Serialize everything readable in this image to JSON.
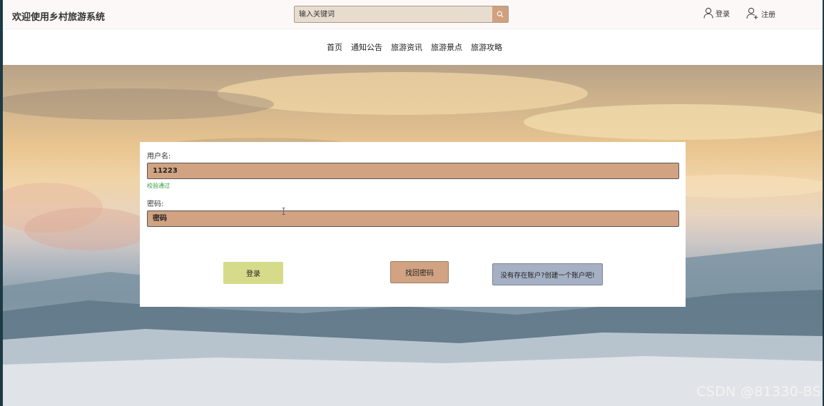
{
  "header": {
    "site_title": "欢迎使用乡村旅游系统",
    "search_placeholder": "输入关键词",
    "search_icon": "search-icon",
    "login_label": "登录",
    "login_icon": "user-icon",
    "register_label": "注册",
    "register_icon": "user-plus-icon"
  },
  "nav": {
    "items": [
      "首页",
      "通知公告",
      "旅游资讯",
      "旅游景点",
      "旅游攻略"
    ]
  },
  "form": {
    "username_label": "用户名:",
    "username_value": "11223",
    "validation_message": "校验通过",
    "password_label": "密码:",
    "password_placeholder": "密码",
    "login_button": "登录",
    "forgot_button": "找回密码",
    "register_button": "没有存在账户?创建一个账户吧!"
  },
  "watermark": "CSDN @81330-BS",
  "colors": {
    "input_bg": "#d1a382",
    "login_btn": "#d6db8b",
    "forgot_btn": "#d1a382",
    "register_btn": "#a5b0c4",
    "validation": "#2e9a3a"
  }
}
